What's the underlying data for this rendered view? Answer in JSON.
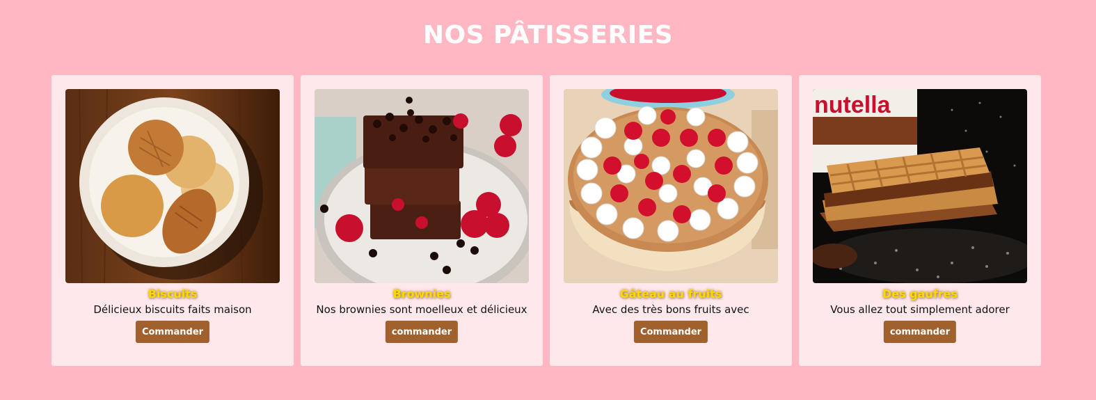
{
  "page": {
    "title": "NOS PÂTISSERIES"
  },
  "colors": {
    "background": "#ffb7c3",
    "card_background": "#ffe8eb",
    "title_text": "#ffffff",
    "card_title": "#ffd700",
    "button": "#a0612f",
    "button_text": "#ffffff"
  },
  "cards": [
    {
      "title": "Biscuits",
      "description": "Délicieux biscuits faits maison",
      "button_label": "Commander"
    },
    {
      "title": "Brownies",
      "description": "Nos brownies sont moelleux et délicieux",
      "button_label": "commander"
    },
    {
      "title": "Gâteau au fruits",
      "description": "Avec des très bons fruits avec",
      "button_label": "Commander"
    },
    {
      "title": "Des gaufres",
      "description": "Vous allez tout simplement adorer",
      "button_label": "commander",
      "image_text": "nutella"
    }
  ]
}
